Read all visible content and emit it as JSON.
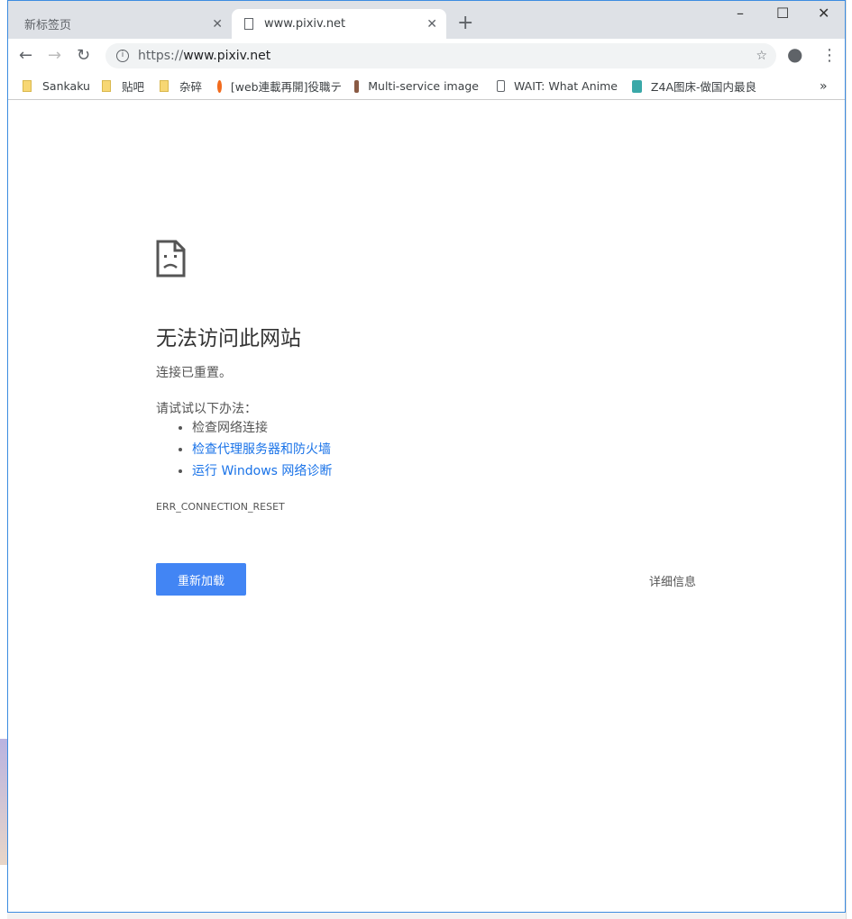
{
  "tabs": [
    {
      "label": "新标签页",
      "close": "✕"
    },
    {
      "label": "www.pixiv.net",
      "close": "✕"
    }
  ],
  "new_tab": "+",
  "window_controls": {
    "minimize": "–",
    "maximize": "☐",
    "close": "✕"
  },
  "omnibox": {
    "scheme": "https://",
    "host": "www.pixiv.net"
  },
  "bookmarks": [
    {
      "label": "Sankaku"
    },
    {
      "label": "贴吧"
    },
    {
      "label": "杂碎"
    },
    {
      "label": "[web連載再開]役職テ"
    },
    {
      "label": "Multi-service image"
    },
    {
      "label": "WAIT: What Anime"
    },
    {
      "label": "Z4A图床-做国内最良"
    }
  ],
  "bookmarks_overflow": "»",
  "error": {
    "title": "无法访问此网站",
    "subtitle": "连接已重置。",
    "try_label": "请试试以下办法：",
    "suggestions": [
      "检查网络连接",
      "检查代理服务器和防火墙",
      "运行 Windows 网络诊断"
    ],
    "code": "ERR_CONNECTION_RESET",
    "reload": "重新加载",
    "details": "详细信息"
  }
}
